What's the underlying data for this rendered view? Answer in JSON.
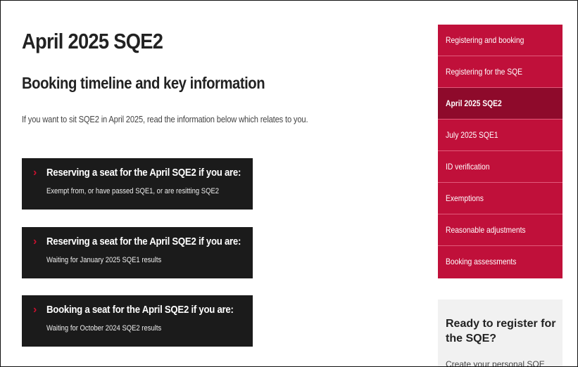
{
  "main": {
    "page_title": "April 2025 SQE2",
    "section_title": "Booking timeline and key information",
    "intro": "If you want to sit SQE2 in April 2025, read the information below which relates to you.",
    "cards": [
      {
        "title": "Reserving a seat for the April SQE2 if you are:",
        "subtitle": "Exempt from, or have passed SQE1, or are resitting SQE2"
      },
      {
        "title": "Reserving a seat for the April SQE2 if you are:",
        "subtitle": "Waiting for January 2025 SQE1 results"
      },
      {
        "title": "Booking a seat for the April SQE2 if you are:",
        "subtitle": "Waiting for October 2024 SQE2 results"
      }
    ],
    "chevron_icon": "chevron-right-icon"
  },
  "sidebar": {
    "accent_color": "#c0103a",
    "active_color": "#8e0a2b",
    "items": [
      {
        "label": "Registering and booking",
        "active": false
      },
      {
        "label": "Registering for the SQE",
        "active": false
      },
      {
        "label": "April 2025 SQE2",
        "active": true
      },
      {
        "label": "July 2025 SQE1",
        "active": false
      },
      {
        "label": "ID verification",
        "active": false
      },
      {
        "label": "Exemptions",
        "active": false
      },
      {
        "label": "Reasonable adjustments",
        "active": false
      },
      {
        "label": "Booking assessments",
        "active": false
      }
    ]
  },
  "ready_box": {
    "title": "Ready to register for the SQE?",
    "text": "Create your personal SQE"
  }
}
